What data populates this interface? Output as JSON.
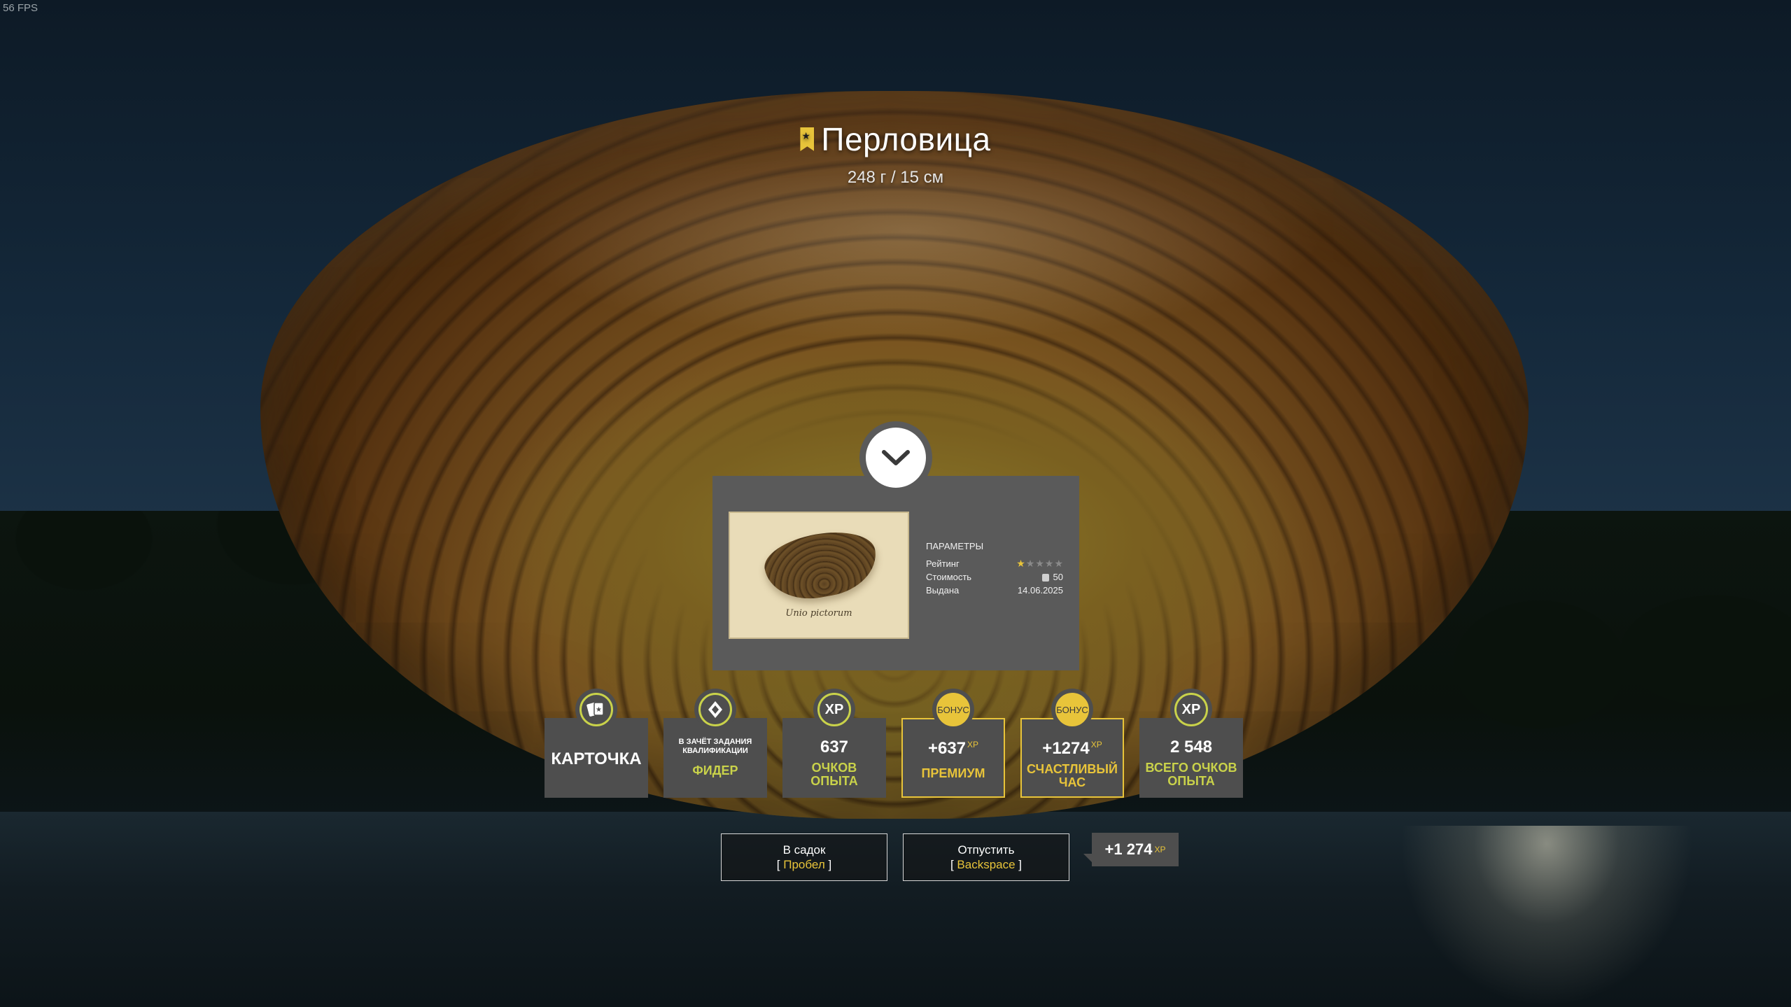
{
  "hud": {
    "fps": "56 FPS"
  },
  "catch": {
    "name": "Перловица",
    "stats": "248 г  /  15 см"
  },
  "card": {
    "caption": "Unio pictorum",
    "params_title": "ПАРАМЕТРЫ",
    "rating_label": "Рейтинг",
    "rating_stars": 1,
    "rating_max": 5,
    "cost_label": "Стоимость",
    "cost_value": "50",
    "issued_label": "Выдана",
    "issued_value": "14.06.2025"
  },
  "rewards": {
    "card": {
      "label": "КАРТОЧКА",
      "icon": "cards-icon"
    },
    "qualification": {
      "line1": "В ЗАЧЁТ ЗАДАНИЯ",
      "line2": "КВАЛИФИКАЦИИ",
      "value": "ФИДЕР",
      "icon": "diamond-icon"
    },
    "xp": {
      "badge": "XP",
      "value": "637",
      "label1": "ОЧКОВ",
      "label2": "ОПЫТА"
    },
    "premium": {
      "badge": "БОНУС",
      "value": "+637",
      "unit": "XP",
      "label": "ПРЕМИУМ"
    },
    "happy_hour": {
      "badge": "БОНУС",
      "value": "+1274",
      "unit": "XP",
      "label1": "СЧАСТЛИВЫЙ",
      "label2": "ЧАС"
    },
    "total": {
      "badge": "XP",
      "value": "2 548",
      "label1": "ВСЕГО ОЧКОВ",
      "label2": "ОПЫТА"
    }
  },
  "actions": {
    "keep": {
      "label": "В садок",
      "key": "Пробел"
    },
    "release": {
      "label": "Отпустить",
      "key": "Backspace"
    },
    "xp_gain": {
      "value": "+1 274",
      "unit": "XP"
    }
  },
  "colors": {
    "accent_gold": "#e8c43a",
    "accent_green": "#c9d24a",
    "panel": "#5a5a5a",
    "tile": "#4e4e4e"
  }
}
